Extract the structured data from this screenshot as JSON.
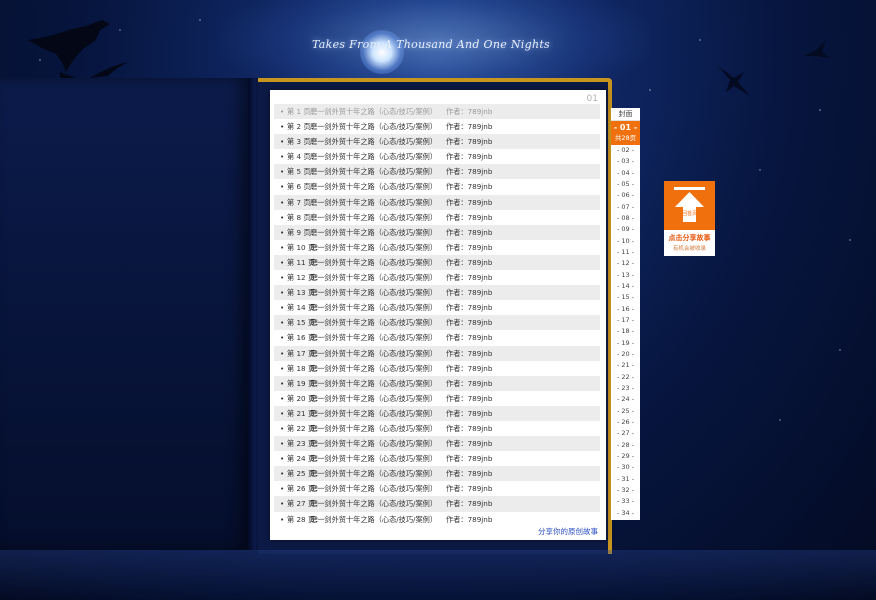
{
  "header": {
    "title": "Takes From A Thousand And One Nights"
  },
  "panel": {
    "page_number": "01",
    "share_link": "分享你的原创故事"
  },
  "toc": [
    {
      "bullet": "•",
      "page": "第  1  页：",
      "title": "磨一剑外贸十年之路（心态/技巧/案例）",
      "author": "作者：789jnb"
    },
    {
      "bullet": "•",
      "page": "第  2  页：",
      "title": "磨一剑外贸十年之路（心态/技巧/案例）",
      "author": "作者：789jnb"
    },
    {
      "bullet": "•",
      "page": "第  3  页：",
      "title": "磨一剑外贸十年之路（心态/技巧/案例）",
      "author": "作者：789jnb"
    },
    {
      "bullet": "•",
      "page": "第  4  页：",
      "title": "磨一剑外贸十年之路（心态/技巧/案例）",
      "author": "作者：789jnb"
    },
    {
      "bullet": "•",
      "page": "第  5  页：",
      "title": "磨一剑外贸十年之路（心态/技巧/案例）",
      "author": "作者：789jnb"
    },
    {
      "bullet": "•",
      "page": "第  6  页：",
      "title": "磨一剑外贸十年之路（心态/技巧/案例）",
      "author": "作者：789jnb"
    },
    {
      "bullet": "•",
      "page": "第  7  页：",
      "title": "磨一剑外贸十年之路（心态/技巧/案例）",
      "author": "作者：789jnb"
    },
    {
      "bullet": "•",
      "page": "第  8  页：",
      "title": "磨一剑外贸十年之路（心态/技巧/案例）",
      "author": "作者：789jnb"
    },
    {
      "bullet": "•",
      "page": "第  9  页：",
      "title": "磨一剑外贸十年之路（心态/技巧/案例）",
      "author": "作者：789jnb"
    },
    {
      "bullet": "•",
      "page": "第 10 页：",
      "title": "磨一剑外贸十年之路（心态/技巧/案例）",
      "author": "作者：789jnb"
    },
    {
      "bullet": "•",
      "page": "第 11 页：",
      "title": "磨一剑外贸十年之路（心态/技巧/案例）",
      "author": "作者：789jnb"
    },
    {
      "bullet": "•",
      "page": "第 12 页：",
      "title": "磨一剑外贸十年之路（心态/技巧/案例）",
      "author": "作者：789jnb"
    },
    {
      "bullet": "•",
      "page": "第 13 页：",
      "title": "磨一剑外贸十年之路（心态/技巧/案例）",
      "author": "作者：789jnb"
    },
    {
      "bullet": "•",
      "page": "第 14 页：",
      "title": "磨一剑外贸十年之路（心态/技巧/案例）",
      "author": "作者：789jnb"
    },
    {
      "bullet": "•",
      "page": "第 15 页：",
      "title": "磨一剑外贸十年之路（心态/技巧/案例）",
      "author": "作者：789jnb"
    },
    {
      "bullet": "•",
      "page": "第 16 页：",
      "title": "磨一剑外贸十年之路（心态/技巧/案例）",
      "author": "作者：789jnb"
    },
    {
      "bullet": "•",
      "page": "第 17 页：",
      "title": "磨一剑外贸十年之路（心态/技巧/案例）",
      "author": "作者：789jnb"
    },
    {
      "bullet": "•",
      "page": "第 18 页：",
      "title": "磨一剑外贸十年之路（心态/技巧/案例）",
      "author": "作者：789jnb"
    },
    {
      "bullet": "•",
      "page": "第 19 页：",
      "title": "磨一剑外贸十年之路（心态/技巧/案例）",
      "author": "作者：789jnb"
    },
    {
      "bullet": "•",
      "page": "第 20 页：",
      "title": "磨一剑外贸十年之路（心态/技巧/案例）",
      "author": "作者：789jnb"
    },
    {
      "bullet": "•",
      "page": "第 21 页：",
      "title": "磨一剑外贸十年之路（心态/技巧/案例）",
      "author": "作者：789jnb"
    },
    {
      "bullet": "•",
      "page": "第 22 页：",
      "title": "磨一剑外贸十年之路（心态/技巧/案例）",
      "author": "作者：789jnb"
    },
    {
      "bullet": "•",
      "page": "第 23 页：",
      "title": "磨一剑外贸十年之路（心态/技巧/案例）",
      "author": "作者：789jnb"
    },
    {
      "bullet": "•",
      "page": "第 24 页：",
      "title": "磨一剑外贸十年之路（心态/技巧/案例）",
      "author": "作者：789jnb"
    },
    {
      "bullet": "•",
      "page": "第 25 页：",
      "title": "磨一剑外贸十年之路（心态/技巧/案例）",
      "author": "作者：789jnb"
    },
    {
      "bullet": "•",
      "page": "第 26 页：",
      "title": "磨一剑外贸十年之路（心态/技巧/案例）",
      "author": "作者：789jnb"
    },
    {
      "bullet": "•",
      "page": "第 27 页：",
      "title": "磨一剑外贸十年之路（心态/技巧/案例）",
      "author": "作者：789jnb"
    },
    {
      "bullet": "•",
      "page": "第 28 页：",
      "title": "磨一剑外贸十年之路（心态/技巧/案例）",
      "author": "作者：789jnb"
    }
  ],
  "nav": {
    "cover_label": "封面",
    "current": "- 01 -",
    "total": "共28页",
    "pages": [
      "- 02 -",
      "- 03 -",
      "- 04 -",
      "- 05 -",
      "- 06 -",
      "- 07 -",
      "- 08 -",
      "- 09 -",
      "- 10 -",
      "- 11 -",
      "- 12 -",
      "- 13 -",
      "- 14 -",
      "- 15 -",
      "- 16 -",
      "- 17 -",
      "- 18 -",
      "- 19 -",
      "- 20 -",
      "- 21 -",
      "- 22 -",
      "- 23 -",
      "- 24 -",
      "- 25 -",
      "- 26 -",
      "- 27 -",
      "- 28 -",
      "- 29 -",
      "- 30 -",
      "- 31 -",
      "- 32 -",
      "- 33 -",
      "- 34 -"
    ]
  },
  "promo": {
    "icon_label": "回首页",
    "title": "点击分享故事",
    "subtitle": "有机会被收录",
    "accent": "#f0700e"
  },
  "colors": {
    "accent": "#f0700e",
    "frame_gold": "#c8951f",
    "link": "#2a4fc1"
  }
}
